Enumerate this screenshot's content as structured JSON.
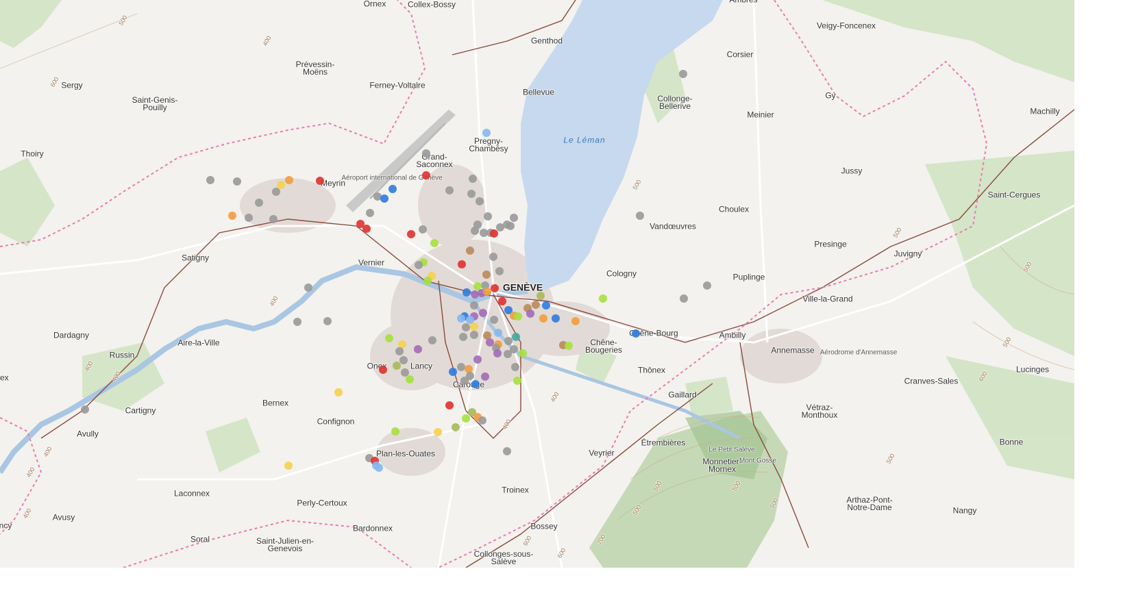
{
  "map": {
    "lake_label": "Le Léman",
    "city_label": "GENÈVE",
    "place_labels": [
      "Ornex",
      "Collex-Bossy",
      "Ambres",
      "Veigy-Foncenex",
      "Sergy",
      "Prévessin-Moëns",
      "Ferney-Voltaire",
      "Genthod",
      "Corsier",
      "Saint-Genis-Pouilly",
      "Bellevue",
      "Collonge-Bellerive",
      "Meinier",
      "Gy",
      "Machilly",
      "Thoiry",
      "Pregny-Chambésy",
      "Grand-Saconnex",
      "Aéroport international de Genève",
      "Meyrin",
      "Jussy",
      "Saint-Cergues",
      "Choulex",
      "Vandœuvres",
      "Presinge",
      "Juvigny",
      "Satigny",
      "Vernier",
      "Cologny",
      "Puplinge",
      "Ville-la-Grand",
      "Dardagny",
      "Aire-la-Ville",
      "Russin",
      "Chêne-Bourg",
      "Ambilly",
      "Chêne-Bougeries",
      "Annemasse",
      "Aérodrome d'Annemasse",
      "Onex",
      "Lancy",
      "Thônex",
      "Lucinges",
      "Carouge",
      "Cranves-Sales",
      "Gaillard",
      "Vétraz-Monthoux",
      "Bernex",
      "Cartigny",
      "Confignon",
      "Avully",
      "Étrembières",
      "Le Petit Salève",
      "Mont Gosse",
      "Monnetier-Mornex",
      "Bonne",
      "Plan-les-Ouates",
      "Veyrier",
      "Laconnex",
      "Perly-Certoux",
      "Troinex",
      "Arthaz-Pont-Notre-Dame",
      "Avusy",
      "Nangy",
      "Soral",
      "Bardonnex",
      "Bossey",
      "Saint-Julien-en-Genevois",
      "Collonges-sous-Salève",
      "lex",
      "ncy"
    ],
    "contour_labels": [
      "500",
      "600",
      "400",
      "500",
      "400",
      "500",
      "400",
      "400",
      "400",
      "400",
      "400",
      "400",
      "500",
      "500",
      "600",
      "500",
      "400",
      "500",
      "500",
      "600",
      "700",
      "500",
      "600",
      "500",
      "400"
    ],
    "marker_colors": {
      "gray": "#999999",
      "red": "#e03030",
      "orange": "#f39c3c",
      "yellow": "#f7d04a",
      "lime": "#a6e03c",
      "purple": "#a26bb8",
      "blue": "#2d7be0",
      "lightblue": "#86b8ee",
      "brown": "#b98a5a",
      "olive": "#a9b85a",
      "teal": "#45a7a0"
    }
  }
}
